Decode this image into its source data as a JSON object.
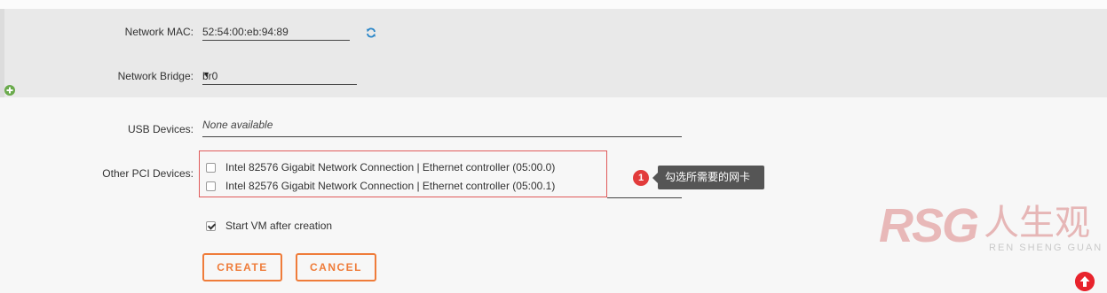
{
  "network": {
    "mac_label": "Network MAC:",
    "mac_value": "52:54:00:eb:94:89",
    "bridge_label": "Network Bridge:",
    "bridge_value": "br0",
    "refresh_icon": "refresh-icon",
    "add_icon": "plus-circle-icon"
  },
  "usb": {
    "label": "USB Devices:",
    "value": "None available"
  },
  "pci": {
    "label": "Other PCI Devices:",
    "items": [
      {
        "label": "Intel 82576 Gigabit Network Connection | Ethernet controller (05:00.0)",
        "checked": false
      },
      {
        "label": "Intel 82576 Gigabit Network Connection | Ethernet controller (05:00.1)",
        "checked": false
      }
    ]
  },
  "start_vm": {
    "label": "Start VM after creation",
    "checked": true
  },
  "annotation": {
    "number": "1",
    "text": "勾选所需要的网卡"
  },
  "buttons": {
    "create": "CREATE",
    "cancel": "CANCEL"
  },
  "watermark": {
    "logo": "RSG",
    "cn": "人生观",
    "pinyin": "REN SHENG GUAN"
  },
  "colors": {
    "accent": "#ef7c3a",
    "annotation_red": "#e23b3b",
    "box_red": "#e05a5a",
    "refresh_blue": "#2a86c8",
    "add_green": "#6aaa4c"
  }
}
